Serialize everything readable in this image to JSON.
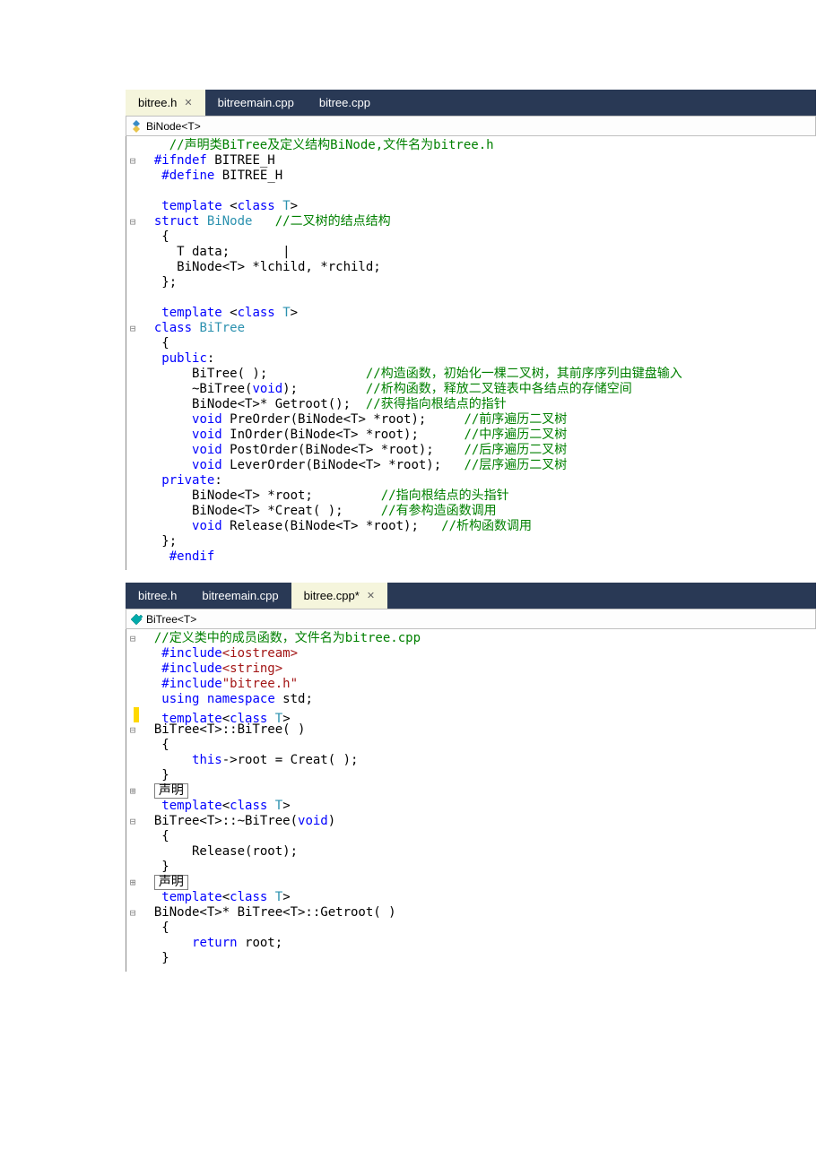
{
  "pane1": {
    "tabs": [
      {
        "label": "bitree.h",
        "active": true,
        "closable": true
      },
      {
        "label": "bitreemain.cpp",
        "active": false,
        "closable": false
      },
      {
        "label": "bitree.cpp",
        "active": false,
        "closable": false
      }
    ],
    "navigator": "BiNode<T>",
    "lines": [
      {
        "f": "",
        "segs": [
          {
            "c": "",
            "t": "    "
          },
          {
            "c": "cm",
            "t": "//声明类BiTree及定义结构BiNode,文件名为bitree.h"
          }
        ]
      },
      {
        "f": "⊟",
        "segs": [
          {
            "c": "",
            "t": "  "
          },
          {
            "c": "kw",
            "t": "#ifndef"
          },
          {
            "c": "",
            "t": " BITREE_H"
          }
        ]
      },
      {
        "f": "",
        "segs": [
          {
            "c": "",
            "t": "   "
          },
          {
            "c": "kw",
            "t": "#define"
          },
          {
            "c": "",
            "t": " BITREE_H"
          }
        ]
      },
      {
        "f": "",
        "segs": [
          {
            "c": "",
            "t": " "
          }
        ]
      },
      {
        "f": "",
        "segs": [
          {
            "c": "",
            "t": "   "
          },
          {
            "c": "kw",
            "t": "template"
          },
          {
            "c": "",
            "t": " <"
          },
          {
            "c": "kw",
            "t": "class"
          },
          {
            "c": "",
            "t": " "
          },
          {
            "c": "cls",
            "t": "T"
          },
          {
            "c": "",
            "t": ">"
          }
        ]
      },
      {
        "f": "⊟",
        "segs": [
          {
            "c": "",
            "t": "  "
          },
          {
            "c": "kw",
            "t": "struct"
          },
          {
            "c": "",
            "t": " "
          },
          {
            "c": "cls",
            "t": "BiNode"
          },
          {
            "c": "",
            "t": "   "
          },
          {
            "c": "cm",
            "t": "//二叉树的结点结构"
          }
        ]
      },
      {
        "f": "",
        "segs": [
          {
            "c": "",
            "t": "   {"
          }
        ]
      },
      {
        "f": "",
        "segs": [
          {
            "c": "",
            "t": "     T data;       |"
          }
        ]
      },
      {
        "f": "",
        "segs": [
          {
            "c": "",
            "t": "     BiNode<T> *lchild, *rchild;"
          }
        ]
      },
      {
        "f": "",
        "segs": [
          {
            "c": "",
            "t": "   };"
          }
        ]
      },
      {
        "f": "",
        "segs": [
          {
            "c": "",
            "t": " "
          }
        ]
      },
      {
        "f": "",
        "segs": [
          {
            "c": "",
            "t": "   "
          },
          {
            "c": "kw",
            "t": "template"
          },
          {
            "c": "",
            "t": " <"
          },
          {
            "c": "kw",
            "t": "class"
          },
          {
            "c": "",
            "t": " "
          },
          {
            "c": "cls",
            "t": "T"
          },
          {
            "c": "",
            "t": ">"
          }
        ]
      },
      {
        "f": "⊟",
        "segs": [
          {
            "c": "",
            "t": "  "
          },
          {
            "c": "kw",
            "t": "class"
          },
          {
            "c": "",
            "t": " "
          },
          {
            "c": "cls",
            "t": "BiTree"
          }
        ]
      },
      {
        "f": "",
        "segs": [
          {
            "c": "",
            "t": "   {"
          }
        ]
      },
      {
        "f": "",
        "segs": [
          {
            "c": "",
            "t": "   "
          },
          {
            "c": "kw",
            "t": "public"
          },
          {
            "c": "",
            "t": ":"
          }
        ]
      },
      {
        "f": "",
        "segs": [
          {
            "c": "",
            "t": "       BiTree( );             "
          },
          {
            "c": "cm",
            "t": "//构造函数，初始化一棵二叉树，其前序序列由键盘输入"
          }
        ]
      },
      {
        "f": "",
        "segs": [
          {
            "c": "",
            "t": "       ~BiTree("
          },
          {
            "c": "kw",
            "t": "void"
          },
          {
            "c": "",
            "t": ");         "
          },
          {
            "c": "cm",
            "t": "//析构函数，释放二叉链表中各结点的存储空间"
          }
        ]
      },
      {
        "f": "",
        "segs": [
          {
            "c": "",
            "t": "       BiNode<T>* Getroot();  "
          },
          {
            "c": "cm",
            "t": "//获得指向根结点的指针"
          }
        ]
      },
      {
        "f": "",
        "segs": [
          {
            "c": "",
            "t": "       "
          },
          {
            "c": "kw",
            "t": "void"
          },
          {
            "c": "",
            "t": " PreOrder(BiNode<T> *root);     "
          },
          {
            "c": "cm",
            "t": "//前序遍历二叉树"
          }
        ]
      },
      {
        "f": "",
        "segs": [
          {
            "c": "",
            "t": "       "
          },
          {
            "c": "kw",
            "t": "void"
          },
          {
            "c": "",
            "t": " InOrder(BiNode<T> *root);      "
          },
          {
            "c": "cm",
            "t": "//中序遍历二叉树"
          }
        ]
      },
      {
        "f": "",
        "segs": [
          {
            "c": "",
            "t": "       "
          },
          {
            "c": "kw",
            "t": "void"
          },
          {
            "c": "",
            "t": " PostOrder(BiNode<T> *root);    "
          },
          {
            "c": "cm",
            "t": "//后序遍历二叉树"
          }
        ]
      },
      {
        "f": "",
        "segs": [
          {
            "c": "",
            "t": "       "
          },
          {
            "c": "kw",
            "t": "void"
          },
          {
            "c": "",
            "t": " LeverOrder(BiNode<T> *root);   "
          },
          {
            "c": "cm",
            "t": "//层序遍历二叉树"
          }
        ]
      },
      {
        "f": "",
        "segs": [
          {
            "c": "",
            "t": "   "
          },
          {
            "c": "kw",
            "t": "private"
          },
          {
            "c": "",
            "t": ":"
          }
        ]
      },
      {
        "f": "",
        "segs": [
          {
            "c": "",
            "t": "       BiNode<T> *root;         "
          },
          {
            "c": "cm",
            "t": "//指向根结点的头指针"
          }
        ]
      },
      {
        "f": "",
        "segs": [
          {
            "c": "",
            "t": "       BiNode<T> *Creat( );     "
          },
          {
            "c": "cm",
            "t": "//有参构造函数调用"
          }
        ]
      },
      {
        "f": "",
        "segs": [
          {
            "c": "",
            "t": "       "
          },
          {
            "c": "kw",
            "t": "void"
          },
          {
            "c": "",
            "t": " Release(BiNode<T> *root);   "
          },
          {
            "c": "cm",
            "t": "//析构函数调用"
          }
        ]
      },
      {
        "f": "",
        "segs": [
          {
            "c": "",
            "t": "   };"
          }
        ]
      },
      {
        "f": "",
        "segs": [
          {
            "c": "",
            "t": "    "
          },
          {
            "c": "kw",
            "t": "#endif"
          }
        ]
      }
    ]
  },
  "pane2": {
    "tabs": [
      {
        "label": "bitree.h",
        "active": false,
        "closable": false
      },
      {
        "label": "bitreemain.cpp",
        "active": false,
        "closable": false
      },
      {
        "label": "bitree.cpp*",
        "active": true,
        "closable": true
      }
    ],
    "navigator": "BiTree<T>",
    "lines": [
      {
        "f": "⊟",
        "mark": "",
        "segs": [
          {
            "c": "",
            "t": "  "
          },
          {
            "c": "cm",
            "t": "//定义类中的成员函数，文件名为bitree.cpp"
          }
        ]
      },
      {
        "f": "",
        "segs": [
          {
            "c": "",
            "t": "   "
          },
          {
            "c": "kw",
            "t": "#include"
          },
          {
            "c": "str",
            "t": "<iostream>"
          }
        ]
      },
      {
        "f": "",
        "segs": [
          {
            "c": "",
            "t": "   "
          },
          {
            "c": "kw",
            "t": "#include"
          },
          {
            "c": "str",
            "t": "<string>"
          }
        ]
      },
      {
        "f": "",
        "segs": [
          {
            "c": "",
            "t": "   "
          },
          {
            "c": "kw",
            "t": "#include"
          },
          {
            "c": "str",
            "t": "\"bitree.h\""
          }
        ]
      },
      {
        "f": "",
        "segs": [
          {
            "c": "",
            "t": "   "
          },
          {
            "c": "kw",
            "t": "using"
          },
          {
            "c": "",
            "t": " "
          },
          {
            "c": "kw",
            "t": "namespace"
          },
          {
            "c": "",
            "t": " std;"
          }
        ]
      },
      {
        "f": "",
        "mark": "y",
        "segs": [
          {
            "c": "",
            "t": "   "
          },
          {
            "c": "kw",
            "t": "template"
          },
          {
            "c": "",
            "t": "<"
          },
          {
            "c": "kw",
            "t": "class"
          },
          {
            "c": "",
            "t": " "
          },
          {
            "c": "cls",
            "t": "T"
          },
          {
            "c": "",
            "t": ">"
          }
        ]
      },
      {
        "f": "⊟",
        "segs": [
          {
            "c": "",
            "t": "  BiTree<T>::BiTree( )"
          }
        ]
      },
      {
        "f": "",
        "segs": [
          {
            "c": "",
            "t": "   {"
          }
        ]
      },
      {
        "f": "",
        "segs": [
          {
            "c": "",
            "t": "       "
          },
          {
            "c": "kw",
            "t": "this"
          },
          {
            "c": "",
            "t": "->root = Creat( );"
          }
        ]
      },
      {
        "f": "",
        "segs": [
          {
            "c": "",
            "t": "   }"
          }
        ]
      },
      {
        "f": "⊞",
        "box": "声明",
        "segs": []
      },
      {
        "f": "",
        "segs": [
          {
            "c": "",
            "t": "   "
          },
          {
            "c": "kw",
            "t": "template"
          },
          {
            "c": "",
            "t": "<"
          },
          {
            "c": "kw",
            "t": "class"
          },
          {
            "c": "",
            "t": " "
          },
          {
            "c": "cls",
            "t": "T"
          },
          {
            "c": "",
            "t": ">"
          }
        ]
      },
      {
        "f": "⊟",
        "segs": [
          {
            "c": "",
            "t": "  BiTree<T>::~BiTree("
          },
          {
            "c": "kw",
            "t": "void"
          },
          {
            "c": "",
            "t": ")"
          }
        ]
      },
      {
        "f": "",
        "segs": [
          {
            "c": "",
            "t": "   {"
          }
        ]
      },
      {
        "f": "",
        "segs": [
          {
            "c": "",
            "t": "       Release(root);"
          }
        ]
      },
      {
        "f": "",
        "segs": [
          {
            "c": "",
            "t": "   }"
          }
        ]
      },
      {
        "f": "⊞",
        "box": "声明",
        "segs": []
      },
      {
        "f": "",
        "segs": [
          {
            "c": "",
            "t": "   "
          },
          {
            "c": "kw",
            "t": "template"
          },
          {
            "c": "",
            "t": "<"
          },
          {
            "c": "kw",
            "t": "class"
          },
          {
            "c": "",
            "t": " "
          },
          {
            "c": "cls",
            "t": "T"
          },
          {
            "c": "",
            "t": ">"
          }
        ]
      },
      {
        "f": "⊟",
        "segs": [
          {
            "c": "",
            "t": "  BiNode<T>* BiTree<T>::Getroot( )"
          }
        ]
      },
      {
        "f": "",
        "segs": [
          {
            "c": "",
            "t": "   {"
          }
        ]
      },
      {
        "f": "",
        "segs": [
          {
            "c": "",
            "t": "       "
          },
          {
            "c": "kw",
            "t": "return"
          },
          {
            "c": "",
            "t": " root;"
          }
        ]
      },
      {
        "f": "",
        "segs": [
          {
            "c": "",
            "t": "   }"
          }
        ]
      }
    ]
  }
}
